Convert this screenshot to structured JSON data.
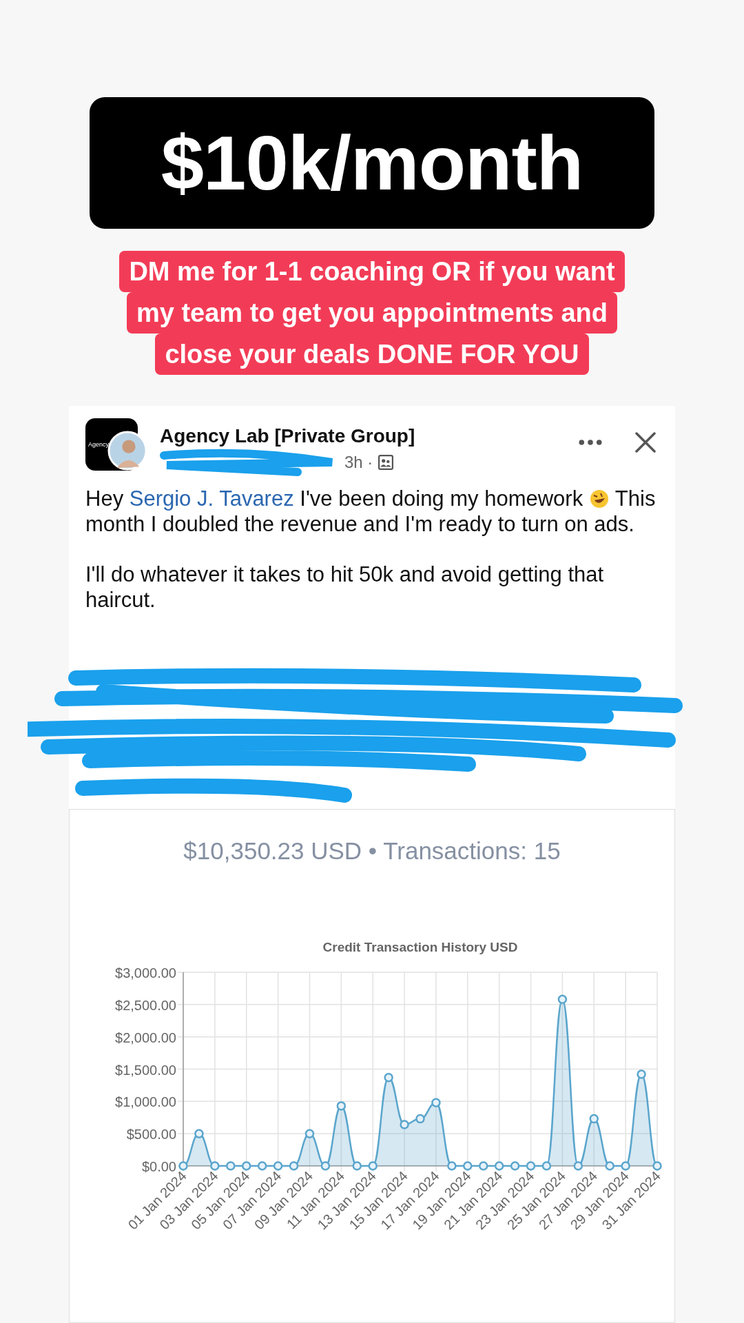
{
  "headline": "$10k/month",
  "callout": [
    "DM me for 1-1 coaching OR if you want",
    "my team to get you appointments and",
    "close your deals DONE FOR YOU"
  ],
  "post": {
    "group": "Agency Lab [Private Group]",
    "avatar_text": "Agency",
    "time": "3h ·",
    "paragraphs": [
      {
        "parts": [
          {
            "kind": "text",
            "text": "Hey "
          },
          {
            "kind": "mention",
            "text": "Sergio J. Tavarez"
          },
          {
            "kind": "text",
            "text": " I've been doing my homework "
          },
          {
            "kind": "emoji"
          },
          {
            "kind": "text",
            "text": " This month I doubled the revenue and I'm ready to turn on ads."
          }
        ]
      },
      {
        "parts": [
          {
            "kind": "text",
            "text": "I'll do whatever it takes to hit 50k and avoid getting that haircut."
          }
        ]
      }
    ]
  },
  "summary": "$10,350.23 USD • Transactions: 15",
  "chart_data": {
    "type": "area",
    "title": "Credit Transaction History USD",
    "categories": [
      "01 Jan 2024",
      null,
      "03 Jan 2024",
      null,
      "05 Jan 2024",
      null,
      "07 Jan 2024",
      null,
      "09 Jan 2024",
      null,
      "11 Jan 2024",
      null,
      "13 Jan 2024",
      null,
      "15 Jan 2024",
      null,
      "17 Jan 2024",
      null,
      "19 Jan 2024",
      null,
      "21 Jan 2024",
      null,
      "23 Jan 2024",
      null,
      "25 Jan 2024",
      null,
      "27 Jan 2024",
      null,
      "29 Jan 2024",
      null,
      "31 Jan 2024"
    ],
    "grid": true,
    "series": [
      {
        "color": "#5aa5cc",
        "values": [
          0,
          500,
          0,
          0,
          0,
          0,
          0,
          0,
          500,
          0,
          930,
          0,
          0,
          1370,
          640,
          730,
          980,
          0,
          0,
          0,
          0,
          0,
          0,
          0,
          2580,
          0,
          730,
          0,
          0,
          1420,
          0
        ]
      }
    ],
    "ylim": [
      0,
      3000
    ],
    "yticks": [
      {
        "value": 0,
        "label": "$0.00"
      },
      {
        "value": 500,
        "label": "$500.00"
      },
      {
        "value": 1000,
        "label": "$1,000.00"
      },
      {
        "value": 1500,
        "label": "$1,500.00"
      },
      {
        "value": 2000,
        "label": "$2,000.00"
      },
      {
        "value": 2500,
        "label": "$2,500.00"
      },
      {
        "value": 3000,
        "label": "$3,000.00"
      }
    ]
  }
}
